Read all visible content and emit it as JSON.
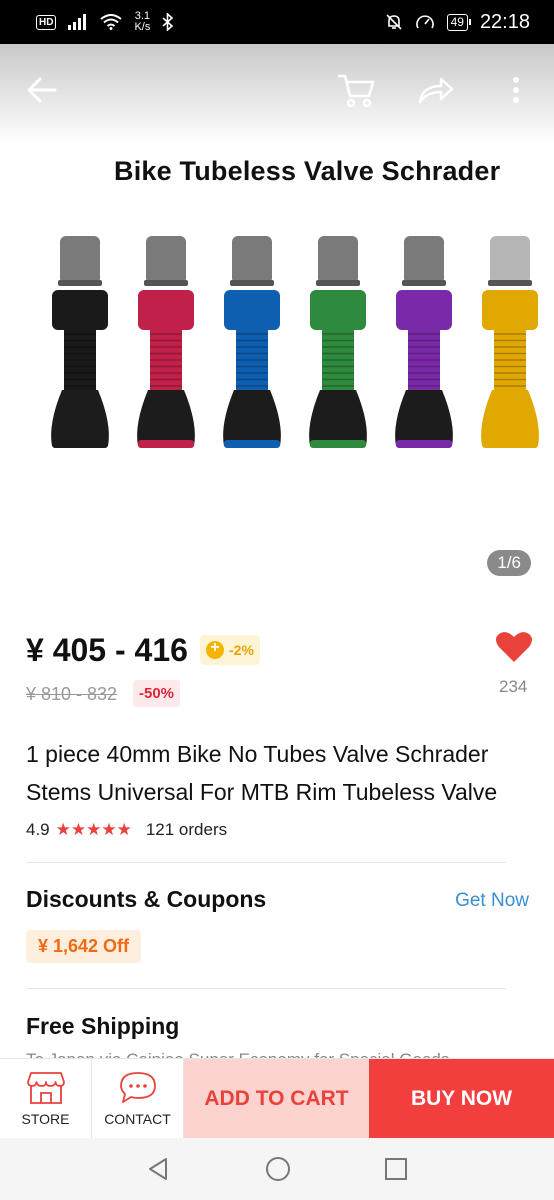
{
  "status_bar": {
    "hd": "HD",
    "speed": "3.1",
    "speed_unit": "K/s",
    "battery": "49",
    "time": "22:18"
  },
  "hero": {
    "title": "Bike Tubeless Valve Schrader",
    "counter": "1/6",
    "valve_colors": [
      "#1a1a1a",
      "#c0204a",
      "#0f5fb0",
      "#2e8a3c",
      "#7a2aa8",
      "#e0a800"
    ]
  },
  "top_nav": {
    "icons": [
      "back-arrow-icon",
      "cart-icon",
      "share-icon",
      "more-icon"
    ]
  },
  "price": {
    "current": "¥ 405 - 416",
    "coin_discount": "-2%",
    "original": "¥ 810 - 832",
    "discount": "-50%",
    "wishlist_count": "234"
  },
  "product": {
    "title": "1 piece 40mm Bike No Tubes Valve Schrader Stems Universal For MTB Rim Tubeless Valve",
    "rating": "4.9",
    "stars": "★★★★★",
    "orders": "121 orders"
  },
  "discounts": {
    "title": "Discounts & Coupons",
    "action": "Get Now",
    "coupon": "¥ 1,642 Off"
  },
  "shipping": {
    "title": "Free Shipping",
    "subtitle": "To Japan via Cainiao Super Economy for Special Goods"
  },
  "action_bar": {
    "store_label": "STORE",
    "contact_label": "CONTACT",
    "add_to_cart_label": "ADD TO CART",
    "buy_now_label": "BUY NOW"
  },
  "colors": {
    "accent_red": "#f33e3e",
    "link_blue": "#3a8fd0",
    "coupon_orange": "#f06a12"
  }
}
